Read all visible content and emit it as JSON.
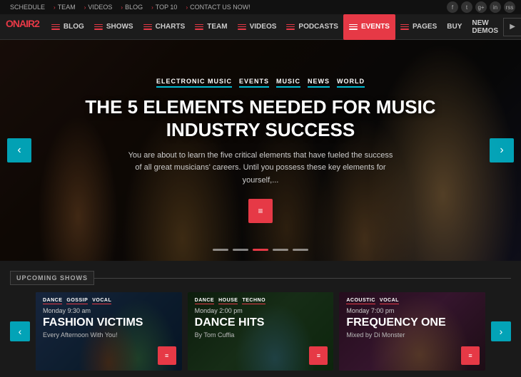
{
  "topbar": {
    "items": [
      {
        "label": "SCHEDULE",
        "arrow": false
      },
      {
        "label": "TEAM",
        "arrow": true
      },
      {
        "label": "VIDEOS",
        "arrow": true
      },
      {
        "label": "BLOG",
        "arrow": true
      },
      {
        "label": "TOP 10",
        "arrow": true
      },
      {
        "label": "CONTACT US NOW!",
        "arrow": true
      }
    ],
    "icons": [
      "f",
      "t",
      "g+",
      "in",
      "rss"
    ]
  },
  "nav": {
    "logo": "ONAIR",
    "logo_sup": "2",
    "items": [
      {
        "label": "BLOG",
        "has_icon": true
      },
      {
        "label": "SHOWS",
        "has_icon": true
      },
      {
        "label": "CHARTS",
        "has_icon": true
      },
      {
        "label": "TEAM",
        "has_icon": true
      },
      {
        "label": "VIDEOS",
        "has_icon": true
      },
      {
        "label": "PODCASTS",
        "has_icon": true
      },
      {
        "label": "EVENTS",
        "has_icon": true,
        "active": true
      },
      {
        "label": "PAGES",
        "has_icon": true
      },
      {
        "label": "BUY"
      },
      {
        "label": "NEW DEMOS"
      }
    ]
  },
  "hero": {
    "tags": [
      "ELECTRONIC MUSIC",
      "EVENTS",
      "MUSIC",
      "NEWS",
      "WORLD"
    ],
    "title": "THE 5 ELEMENTS NEEDED FOR MUSIC INDUSTRY SUCCESS",
    "description": "You are about to learn the five critical elements that have fueled the success of all great musicians' careers. Until you possess these key elements for yourself,...",
    "btn_icon": "≡",
    "dots": [
      1,
      2,
      3,
      4,
      5
    ],
    "active_dot": 3
  },
  "shows": {
    "section_label": "UPCOMING SHOWS",
    "cards": [
      {
        "tags": [
          "DANCE",
          "GOSSIP",
          "VOCAL"
        ],
        "time": "Monday 9:30 am",
        "title": "FASHION VICTIMS",
        "subtitle": "Every Afternoon With You!",
        "btn_icon": "≡"
      },
      {
        "tags": [
          "DANCE",
          "HOUSE",
          "TECHNO"
        ],
        "time": "Monday 2:00 pm",
        "title": "DANCE HITS",
        "subtitle": "By Tom Cuffia",
        "btn_icon": "≡"
      },
      {
        "tags": [
          "ACOUSTIC",
          "VOCAL"
        ],
        "time": "Monday 7:00 pm",
        "title": "FREQUENCY ONE",
        "subtitle": "Mixed by Di Monster",
        "btn_icon": "≡"
      }
    ]
  }
}
